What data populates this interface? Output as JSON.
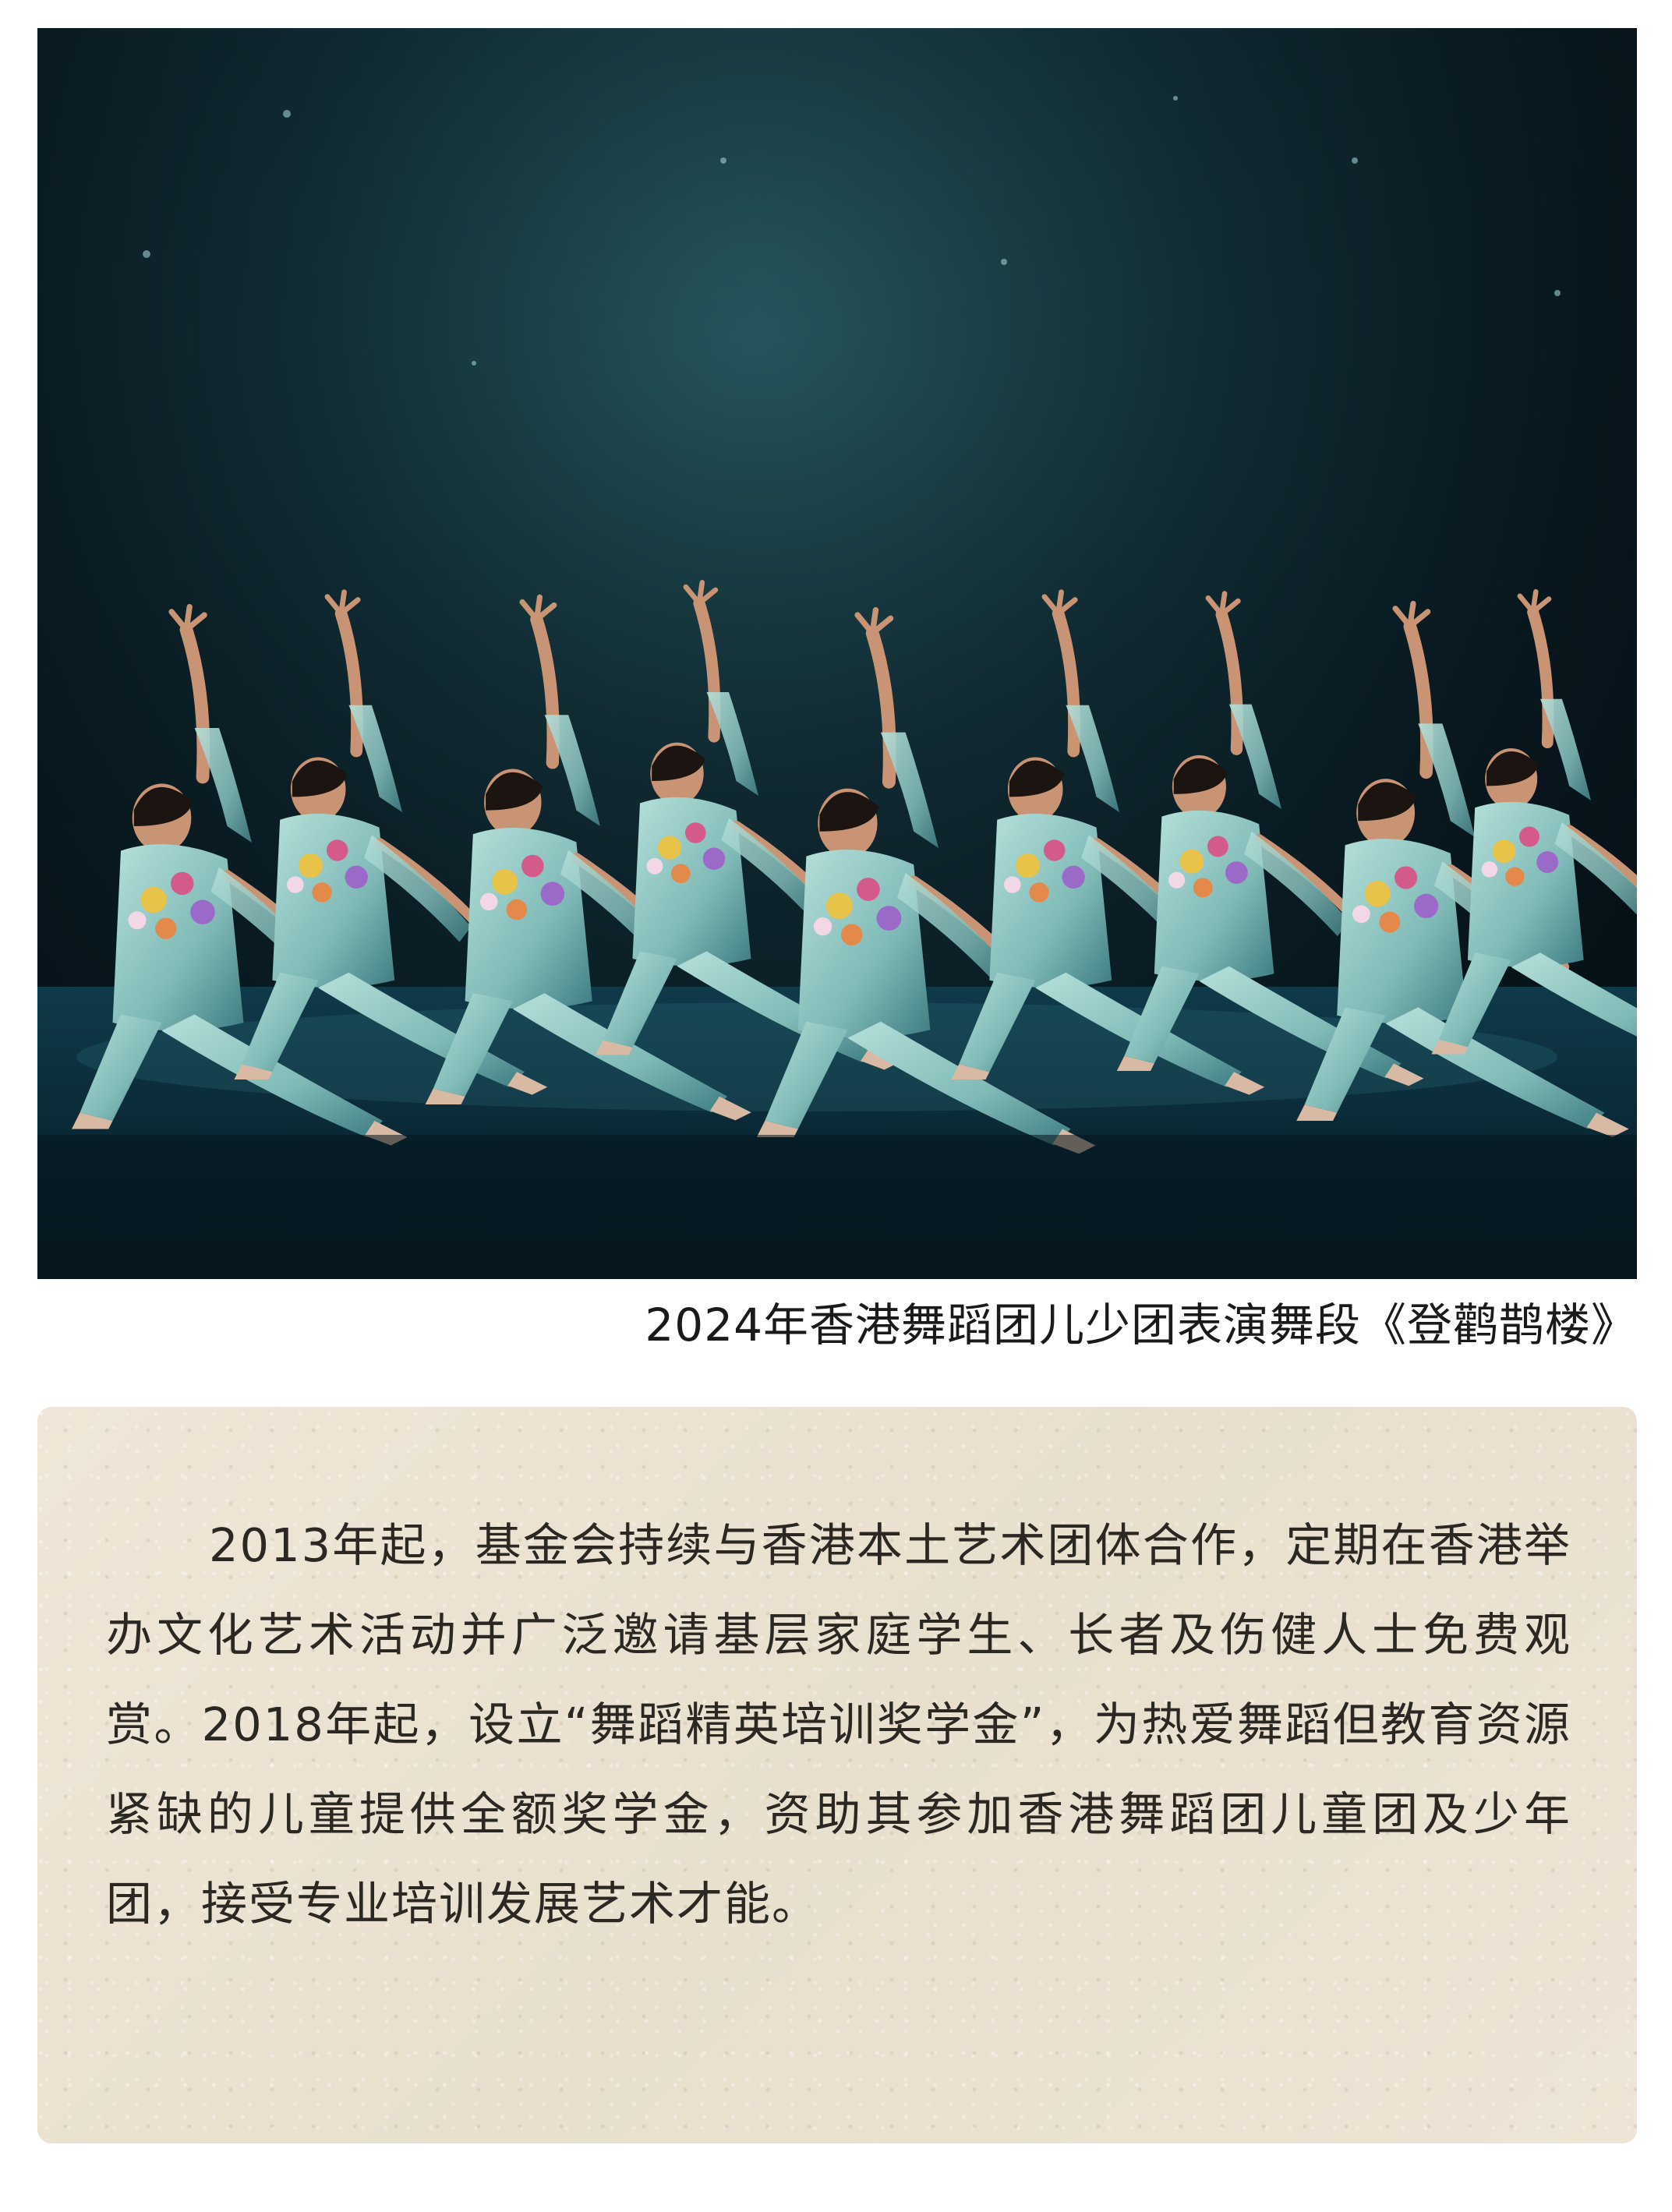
{
  "photo": {
    "subject": "dance-performance-photo",
    "colors": {
      "stage_dark": "#08161d",
      "stage_mid": "#1f4a52",
      "costume": "#8fc7c3",
      "costume_shadow": "#4f8f93",
      "skin": "#c99474"
    }
  },
  "caption": "2024年香港舞蹈团儿少团表演舞段《登鹳鹊楼》",
  "article": {
    "paragraph": "2013年起，基金会持续与香港本土艺术团体合作，定期在香港举办文化艺术活动并广泛邀请基层家庭学生、长者及伤健人士免费观赏。2018年起，设立“舞蹈精英培训奖学金”，为热爱舞蹈但教育资源紧缺的儿童提供全额奖学金，资助其参加香港舞蹈团儿童团及少年团，接受专业培训发展艺术才能。"
  }
}
